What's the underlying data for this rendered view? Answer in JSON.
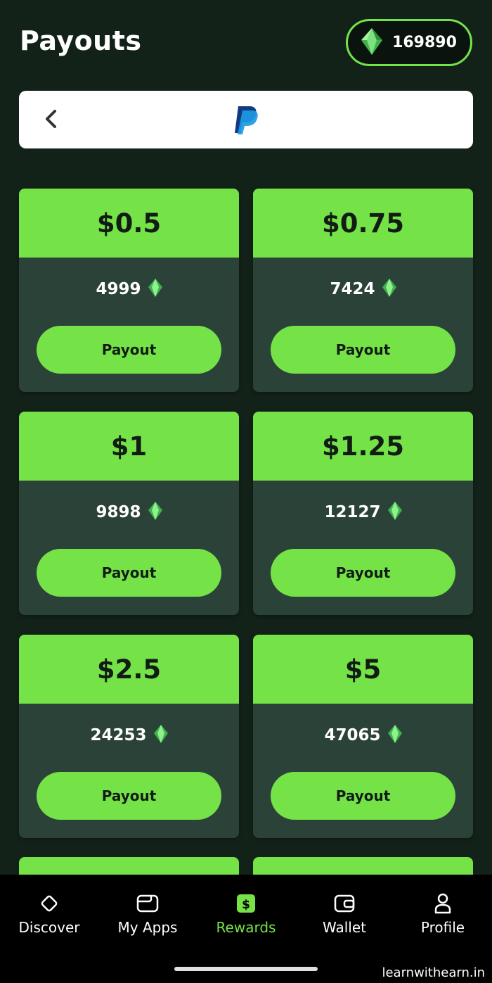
{
  "header": {
    "title": "Payouts",
    "balance": "169890",
    "balance_icon": "gem-icon"
  },
  "provider": {
    "name": "PayPal",
    "back_icon": "chevron-left-icon"
  },
  "rewards": [
    {
      "amount": "$0.5",
      "cost": "4999",
      "button": "Payout"
    },
    {
      "amount": "$0.75",
      "cost": "7424",
      "button": "Payout"
    },
    {
      "amount": "$1",
      "cost": "9898",
      "button": "Payout"
    },
    {
      "amount": "$1.25",
      "cost": "12127",
      "button": "Payout"
    },
    {
      "amount": "$2.5",
      "cost": "24253",
      "button": "Payout"
    },
    {
      "amount": "$5",
      "cost": "47065",
      "button": "Payout"
    }
  ],
  "nav": {
    "items": [
      {
        "label": "Discover",
        "icon": "diamond-icon",
        "active": false
      },
      {
        "label": "My Apps",
        "icon": "apps-folder-icon",
        "active": false
      },
      {
        "label": "Rewards",
        "icon": "dollar-icon",
        "active": true
      },
      {
        "label": "Wallet",
        "icon": "wallet-icon",
        "active": false
      },
      {
        "label": "Profile",
        "icon": "user-icon",
        "active": false
      }
    ]
  },
  "watermark": "learnwithearn.in",
  "colors": {
    "background": "#132219",
    "accent": "#75e248",
    "card": "#2b4239",
    "nav_bg": "#000000"
  }
}
